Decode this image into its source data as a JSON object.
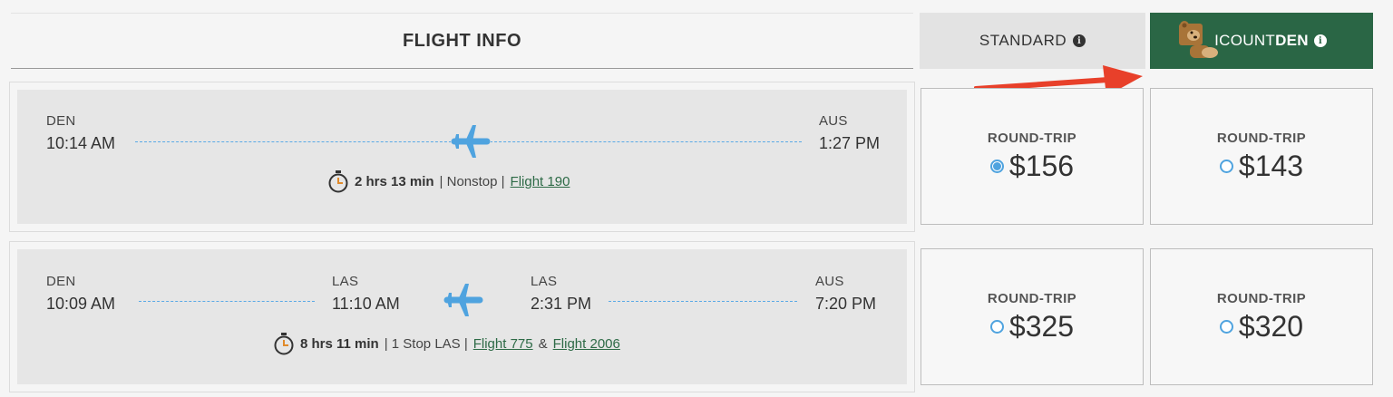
{
  "header": {
    "flight_info": "FLIGHT INFO",
    "standard": "STANDARD",
    "discount_prefix": "I",
    "discount_mid": "COUNT",
    "discount_bold": "DEN",
    "info_glyph": "i"
  },
  "rows": [
    {
      "origin_code": "DEN",
      "origin_time": "10:14 AM",
      "dest_code": "AUS",
      "dest_time": "1:27 PM",
      "duration": "2 hrs 13 min",
      "stops": "| Nonstop |",
      "flight_link": "Flight 190",
      "standard_label": "ROUND-TRIP",
      "standard_price": "$156",
      "standard_selected": true,
      "discount_label": "ROUND-TRIP",
      "discount_price": "$143",
      "discount_selected": false
    },
    {
      "origin_code": "DEN",
      "origin_time": "10:09 AM",
      "layover_arr_code": "LAS",
      "layover_arr_time": "11:10 AM",
      "layover_dep_code": "LAS",
      "layover_dep_time": "2:31 PM",
      "dest_code": "AUS",
      "dest_time": "7:20 PM",
      "duration": "8 hrs 11 min",
      "stops": "| 1 Stop LAS |",
      "flight_link_1": "Flight 775",
      "amp": "&",
      "flight_link_2": "Flight 2006",
      "standard_label": "ROUND-TRIP",
      "standard_price": "$325",
      "standard_selected": false,
      "discount_label": "ROUND-TRIP",
      "discount_price": "$320",
      "discount_selected": false
    }
  ],
  "colors": {
    "brand_green": "#2a6645",
    "accent_blue": "#4fa3df",
    "arrow_red": "#e8402a"
  }
}
